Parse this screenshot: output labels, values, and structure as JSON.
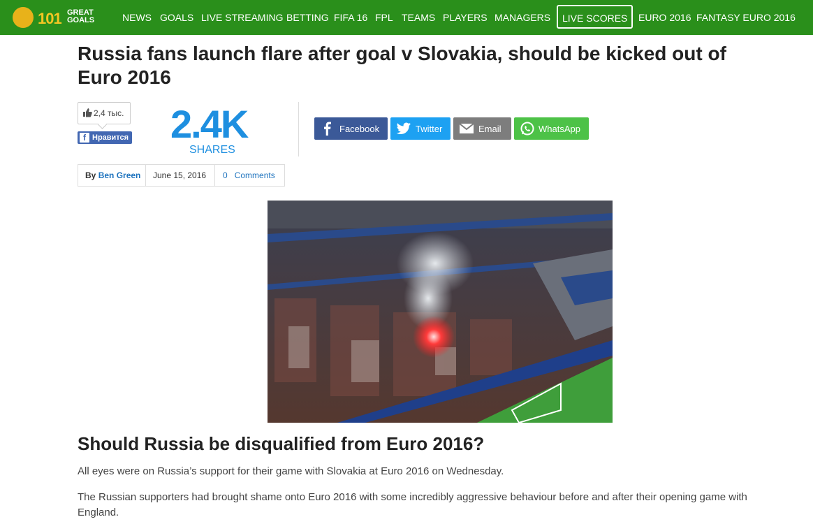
{
  "brand": {
    "num": "101",
    "line1": "GREAT",
    "line2": "GOALS"
  },
  "nav": {
    "items": [
      "NEWS",
      "GOALS",
      "LIVE STREAMING",
      "BETTING",
      "FIFA 16",
      "FPL",
      "TEAMS",
      "PLAYERS",
      "MANAGERS",
      "LIVE SCORES",
      "EURO 2016",
      "FANTASY EURO 2016"
    ]
  },
  "article": {
    "title_line1": "Russia fans launch flare after goal v Slovakia, should be kicked out of",
    "title_line2": "Euro 2016",
    "fb_count": "2,4 тыс.",
    "fb_like": "Нравится",
    "shares_count": "2.4K",
    "shares_label": "SHARES",
    "share_buttons": [
      "Facebook",
      "Twitter",
      "Email",
      "WhatsApp"
    ],
    "meta": {
      "by": "By",
      "author": "Ben Green",
      "date": "June 15, 2016",
      "comments_count": "0",
      "comments_label": "Comments"
    },
    "subheading": "Should Russia be disqualified from Euro 2016?",
    "para1": "All eyes were on Russia’s support for their game with Slovakia at Euro 2016 on Wednesday.",
    "para2_line1": "The Russian supporters had brought shame onto Euro 2016 with some incredibly aggressive behaviour before and after their opening game with",
    "para2_line2": "England."
  },
  "colors": {
    "nav": "#2a8f1b",
    "accent_blue": "#1e8fe0",
    "facebook": "#3b5998",
    "twitter": "#1da1f2",
    "email": "#7d7d7d",
    "whatsapp": "#4dc247"
  }
}
